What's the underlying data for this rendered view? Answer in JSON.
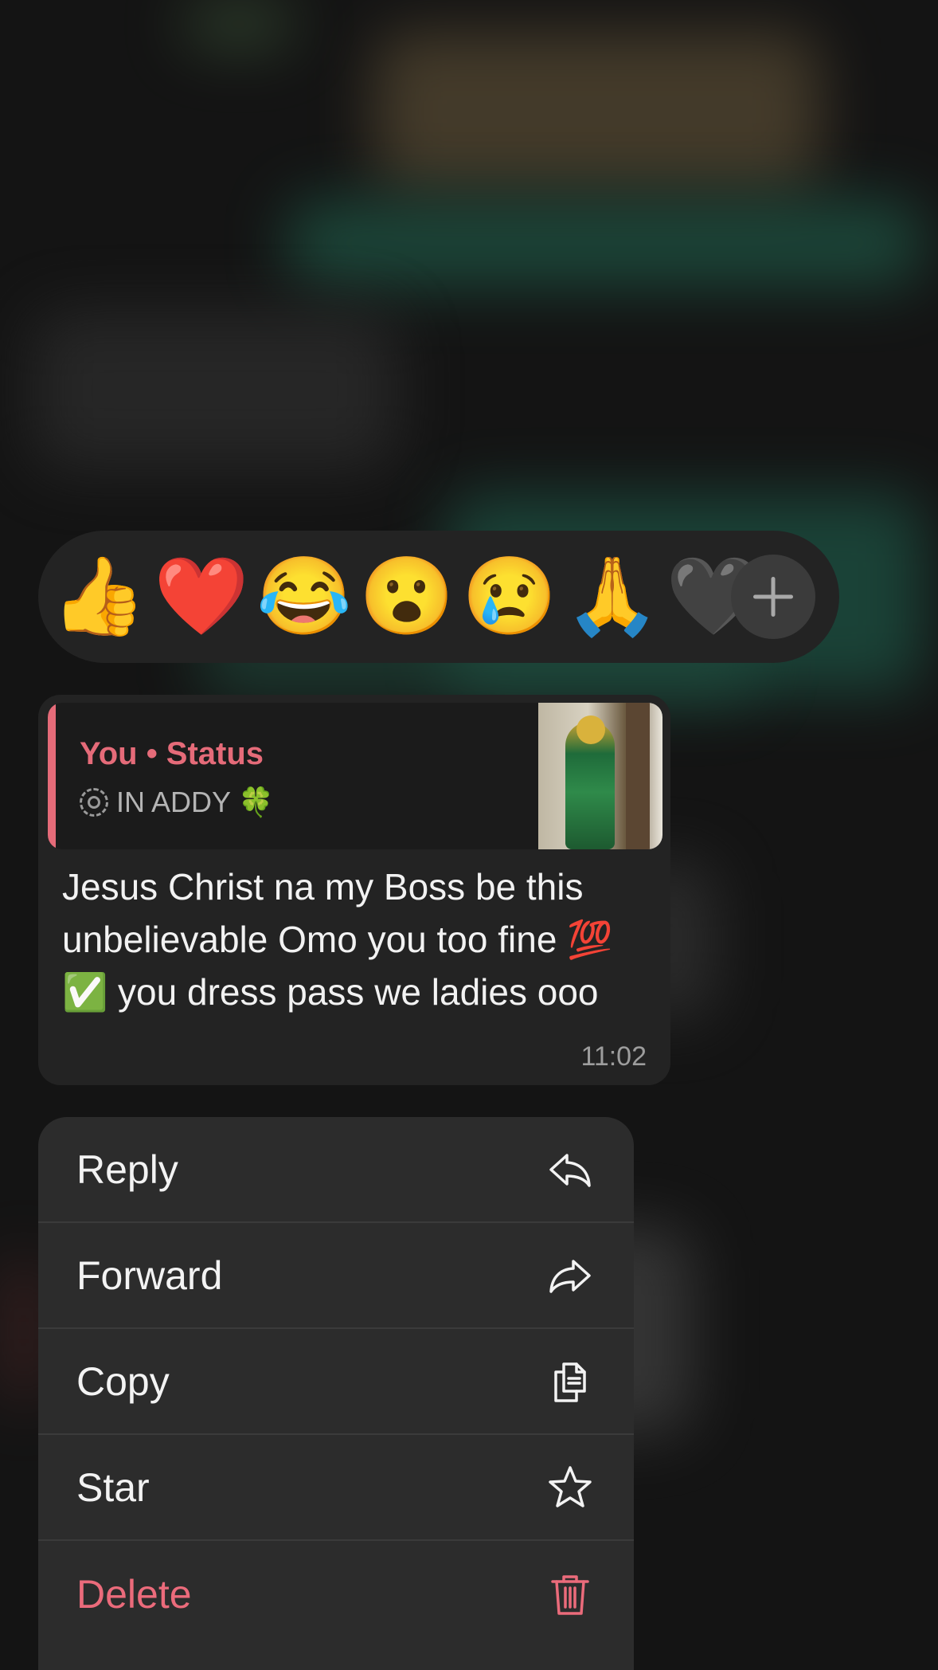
{
  "reactions": {
    "emojis": [
      {
        "name": "thumbs-up",
        "glyph": "👍"
      },
      {
        "name": "red-heart",
        "glyph": "❤️"
      },
      {
        "name": "tears-of-joy",
        "glyph": "😂"
      },
      {
        "name": "surprised",
        "glyph": "😮"
      },
      {
        "name": "crying",
        "glyph": "😢"
      },
      {
        "name": "folded-hands",
        "glyph": "🙏"
      },
      {
        "name": "partial-emoji",
        "glyph": "🖤"
      }
    ],
    "more_icon": "plus-icon"
  },
  "message": {
    "quote": {
      "author": "You • Status",
      "subtitle": "IN ADDY 🍀",
      "status_icon": "status-ring-icon",
      "accent_color": "#e56b79"
    },
    "text": "Jesus Christ na my Boss be this unbelievable Omo you too fine 💯 ✅ you dress pass we ladies ooo",
    "time": "11:02"
  },
  "menu": {
    "items": [
      {
        "label": "Reply",
        "icon": "reply-icon"
      },
      {
        "label": "Forward",
        "icon": "forward-icon"
      },
      {
        "label": "Copy",
        "icon": "copy-icon"
      },
      {
        "label": "Star",
        "icon": "star-icon"
      },
      {
        "label": "Delete",
        "icon": "trash-icon",
        "color": "#eb6b7b"
      }
    ]
  }
}
